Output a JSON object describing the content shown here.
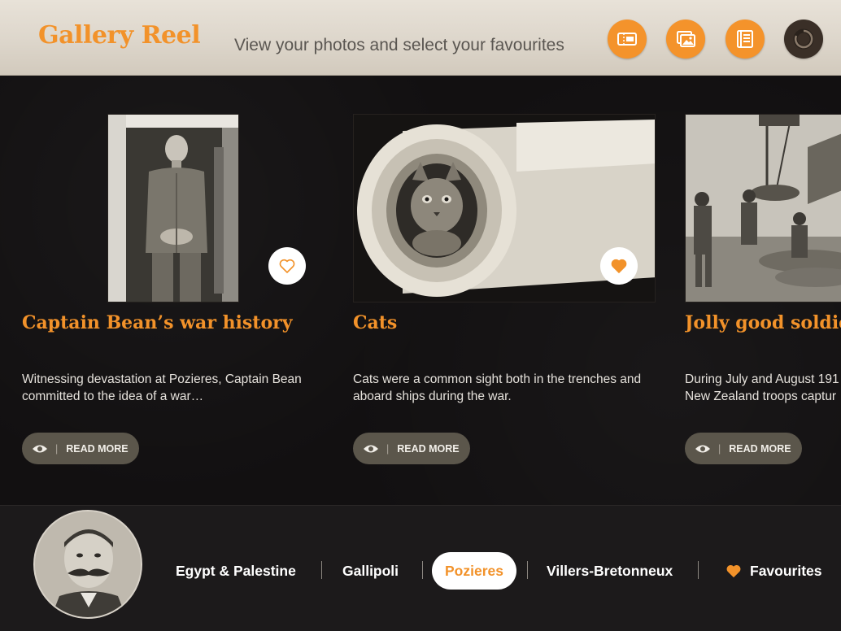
{
  "header": {
    "title": "Gallery Reel",
    "subtitle": "View your photos and select your favourites",
    "buttons": [
      {
        "icon": "ticket-icon"
      },
      {
        "icon": "photos-icon"
      },
      {
        "icon": "list-icon"
      },
      {
        "icon": "reload-icon"
      }
    ]
  },
  "cards": [
    {
      "title": "Captain Bean’s war history",
      "description": "Witnessing devastation at Pozieres, Captain Bean committed to the idea of a war…",
      "read_more": "READ MORE",
      "favourited": false
    },
    {
      "title": "Cats",
      "description": "Cats were a common sight both in the trenches and aboard ships during the war.",
      "read_more": "READ MORE",
      "favourited": true
    },
    {
      "title": "Jolly good soldie",
      "description": "During July and August 191 New Zealand troops captur",
      "read_more": "READ MORE",
      "favourited": false
    }
  ],
  "nav": {
    "items": [
      "Egypt & Palestine",
      "Gallipoli",
      "Pozieres",
      "Villers-Bretonneux",
      "Favourites"
    ],
    "active": "Pozieres"
  },
  "colors": {
    "accent": "#f2922a",
    "button_bg": "#5b564b",
    "background": "#121011"
  }
}
